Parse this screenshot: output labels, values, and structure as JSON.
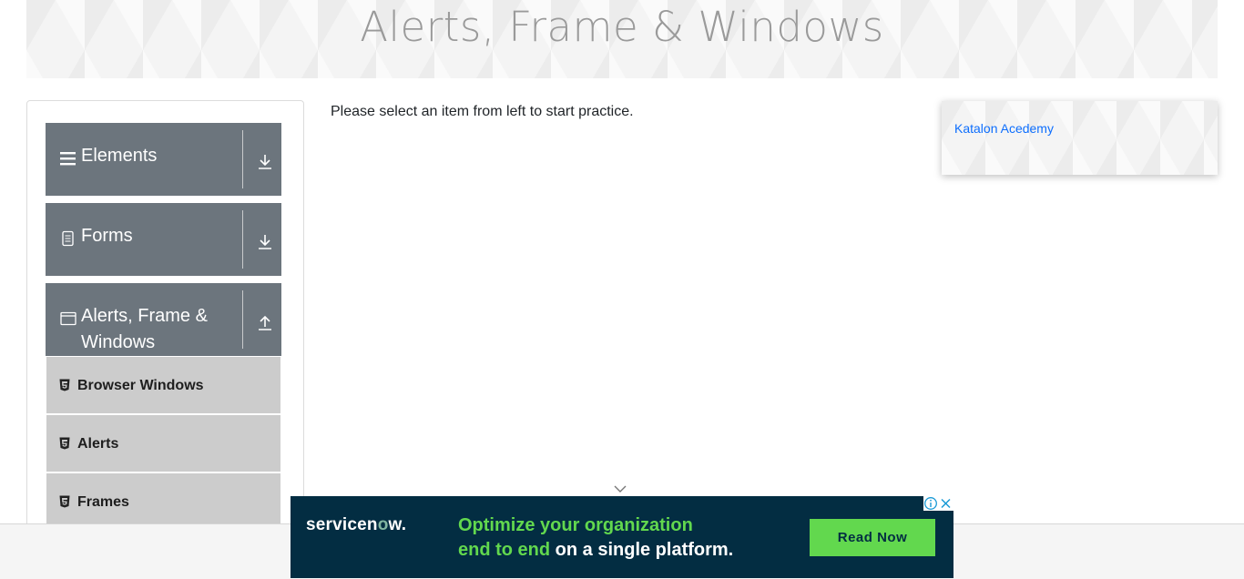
{
  "header": {
    "title": "Alerts, Frame & Windows"
  },
  "sidebar": {
    "groups": [
      {
        "label": "Elements",
        "icon": "list-icon",
        "expanded": false
      },
      {
        "label": "Forms",
        "icon": "document-icon",
        "expanded": false
      },
      {
        "label": "Alerts, Frame & Windows",
        "icon": "window-icon",
        "expanded": true
      }
    ],
    "submenu": [
      {
        "label": "Browser Windows",
        "icon": "html5-icon"
      },
      {
        "label": "Alerts",
        "icon": "html5-icon"
      },
      {
        "label": "Frames",
        "icon": "html5-icon"
      }
    ]
  },
  "main": {
    "instruction": "Please select an item from left to start practice."
  },
  "side_card": {
    "link": "Katalon Acedemy"
  },
  "ad": {
    "brand_prefix": "servicen",
    "brand_o": "o",
    "brand_suffix": "w.",
    "headline_green_1": "Optimize your organization",
    "headline_green_2": "end to end",
    "headline_white": " on a single platform.",
    "cta": "Read Now",
    "colors": {
      "background": "#032d42",
      "accent": "#62d84e"
    }
  },
  "colors": {
    "sidebar_header": "#6c757d",
    "submenu": "#cccccc",
    "link": "#0d6efd"
  }
}
